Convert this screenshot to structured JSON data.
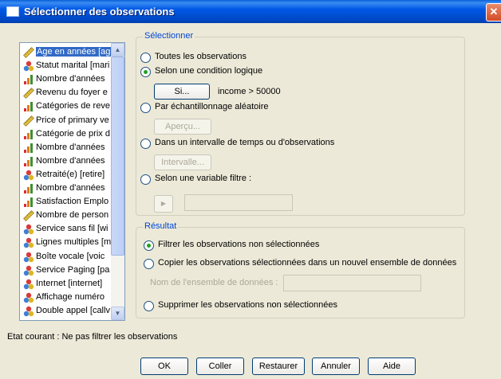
{
  "window": {
    "title": "Sélectionner des observations",
    "close_label": "✕"
  },
  "variables": [
    {
      "label": "Age en années [ag",
      "icon": "ruler-icon",
      "selected": true
    },
    {
      "label": "Statut marital [mari",
      "icon": "nominal-icon"
    },
    {
      "label": "Nombre d'années",
      "icon": "ordinal-icon"
    },
    {
      "label": "Revenu du foyer e",
      "icon": "ruler-icon"
    },
    {
      "label": "Catégories de reve",
      "icon": "ordinal-icon"
    },
    {
      "label": "Price of primary ve",
      "icon": "ruler-icon"
    },
    {
      "label": "Catégorie de prix d",
      "icon": "ordinal-icon"
    },
    {
      "label": "Nombre d'années",
      "icon": "ordinal-icon"
    },
    {
      "label": "Nombre d'années",
      "icon": "ordinal-icon"
    },
    {
      "label": "Retraité(e) [retire]",
      "icon": "nominal-icon"
    },
    {
      "label": "Nombre d'années",
      "icon": "ordinal-icon"
    },
    {
      "label": "Satisfaction Emplo",
      "icon": "ordinal-icon"
    },
    {
      "label": "Nombre de person",
      "icon": "ruler-icon"
    },
    {
      "label": "Service sans fil [wi",
      "icon": "nominal-icon"
    },
    {
      "label": "Lignes multiples [m",
      "icon": "nominal-icon"
    },
    {
      "label": "Boîte vocale [voic",
      "icon": "nominal-icon"
    },
    {
      "label": "Service Paging [pa",
      "icon": "nominal-icon"
    },
    {
      "label": "Internet [internet]",
      "icon": "nominal-icon"
    },
    {
      "label": "Affichage numéro",
      "icon": "nominal-icon"
    },
    {
      "label": "Double appel [callv",
      "icon": "nominal-icon"
    }
  ],
  "select_group": {
    "legend": "Sélectionner",
    "options": {
      "all": {
        "label": "Toutes les observations",
        "checked": false
      },
      "condition": {
        "label": "Selon une condition logique",
        "checked": true
      },
      "random": {
        "label": "Par échantillonnage aléatoire",
        "checked": false
      },
      "range": {
        "label": "Dans un intervalle de temps ou d'observations",
        "checked": false
      },
      "filter": {
        "label": "Selon une variable filtre :",
        "checked": false
      }
    },
    "if_button": "Si...",
    "condition_text": "income > 50000",
    "sample_button": "Aperçu...",
    "range_button": "Intervalle...",
    "filter_arrow": "▶",
    "filter_value": ""
  },
  "result_group": {
    "legend": "Résultat",
    "options": {
      "filter_out": {
        "label": "Filtrer les observations non sélectionnées",
        "checked": true
      },
      "copy": {
        "label": "Copier les observations sélectionnées dans un nouvel ensemble de données",
        "checked": false
      },
      "delete": {
        "label": "Supprimer les observations non sélectionnées",
        "checked": false
      }
    },
    "dataset_label": "Nom de l'ensemble de données :",
    "dataset_value": ""
  },
  "status": "Etat courant : Ne pas filtrer les observations",
  "buttons": {
    "ok": "OK",
    "paste": "Coller",
    "reset": "Restaurer",
    "cancel": "Annuler",
    "help": "Aide"
  },
  "colors": {
    "titlebar": "#0058e6",
    "selection": "#316ac5",
    "legend": "#0046d5",
    "radio_dot": "#21a121"
  }
}
